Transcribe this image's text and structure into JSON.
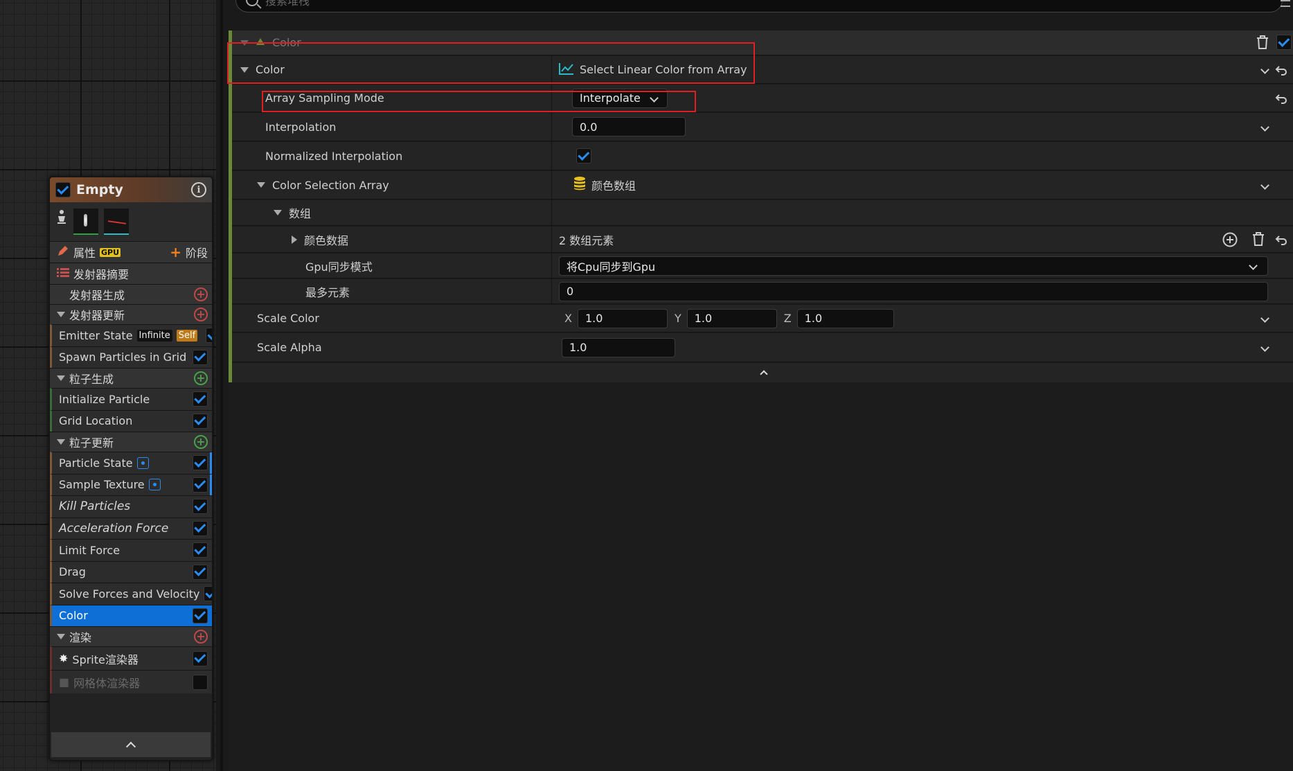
{
  "search": {
    "placeholder": "搜索堆栈"
  },
  "node": {
    "title": "Empty",
    "stack_header": {
      "properties_label": "属性",
      "gpu_badge": "GPU",
      "stage_label": "阶段"
    },
    "summary_label": "发射器摘要",
    "rows": [
      {
        "label": "发射器生成",
        "kind": "section-noarrow",
        "add": "red"
      },
      {
        "label": "发射器更新",
        "kind": "section",
        "add": "red"
      },
      {
        "label": "Emitter State",
        "kind": "item",
        "badges": [
          "Self",
          "Infinite"
        ],
        "checked": true
      },
      {
        "label": "Spawn Particles in Grid",
        "kind": "item",
        "checked": true
      },
      {
        "label": "粒子生成",
        "kind": "section",
        "add": "green"
      },
      {
        "label": "Initialize Particle",
        "kind": "item",
        "checked": true
      },
      {
        "label": "Grid Location",
        "kind": "item",
        "checked": true
      },
      {
        "label": "粒子更新",
        "kind": "section",
        "add": "green"
      },
      {
        "label": "Particle State",
        "kind": "item",
        "dot": true,
        "checked": true
      },
      {
        "label": "Sample Texture",
        "kind": "item",
        "dot": true,
        "checked": true
      },
      {
        "label": "Kill Particles",
        "kind": "item",
        "italic": true,
        "checked": true
      },
      {
        "label": "Acceleration Force",
        "kind": "item",
        "italic": true,
        "checked": true
      },
      {
        "label": "Limit Force",
        "kind": "item",
        "checked": true
      },
      {
        "label": "Drag",
        "kind": "item",
        "checked": true
      },
      {
        "label": "Solve Forces and Velocity",
        "kind": "item",
        "checked": true
      },
      {
        "label": "Color",
        "kind": "item",
        "selected": true,
        "checked": true
      },
      {
        "label": "渲染",
        "kind": "section",
        "add": "red"
      },
      {
        "label": "Sprite渲染器",
        "kind": "render",
        "checked": true
      },
      {
        "label": "网格体渲染器",
        "kind": "render-dim",
        "checked": false
      }
    ]
  },
  "details": {
    "module_title": "Color",
    "color_label": "Color",
    "color_value": "Select Linear Color from Array",
    "array_sampling_mode_label": "Array Sampling Mode",
    "array_sampling_mode_value": "Interpolate",
    "interpolation_label": "Interpolation",
    "interpolation_value": "0.0",
    "normalized_interpolation_label": "Normalized Interpolation",
    "color_selection_array_label": "Color Selection Array",
    "color_selection_array_value": "颜色数组",
    "array_group_label": "数组",
    "color_data_label": "颜色数据",
    "color_data_value": "2 数组元素",
    "gpu_sync_label": "Gpu同步模式",
    "gpu_sync_value": "将Cpu同步到Gpu",
    "max_elements_label": "最多元素",
    "max_elements_value": "0",
    "scale_color_label": "Scale Color",
    "scale_color": {
      "x_label": "X",
      "x": "1.0",
      "y_label": "Y",
      "y": "1.0",
      "z_label": "Z",
      "z": "1.0"
    },
    "scale_alpha_label": "Scale Alpha",
    "scale_alpha_value": "1.0"
  }
}
